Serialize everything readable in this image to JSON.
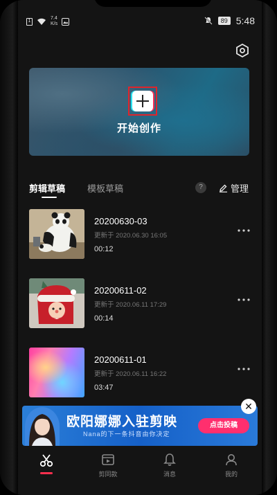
{
  "status_bar": {
    "sim_label": "1",
    "net_speed_value": "7.4",
    "net_speed_unit": "K/s",
    "battery": "89",
    "time": "5:48"
  },
  "hero": {
    "create_label": "开始创作"
  },
  "tabs": {
    "drafts": "剪辑草稿",
    "templates": "模板草稿",
    "help": "?",
    "manage": "管理"
  },
  "drafts": [
    {
      "name": "20200630-03",
      "updated": "更新于 2020.06.30 16:05",
      "duration": "00:12",
      "thumb": "panda"
    },
    {
      "name": "20200611-02",
      "updated": "更新于 2020.06.11 17:29",
      "duration": "00:14",
      "thumb": "santa"
    },
    {
      "name": "20200611-01",
      "updated": "更新于 2020.06.11 16:22",
      "duration": "03:47",
      "thumb": "gradient"
    }
  ],
  "ad": {
    "title": "欧阳娜娜入驻剪映",
    "subtitle": "Nana的下一条抖音由你决定",
    "cta": "点击投稿",
    "close": "✕"
  },
  "nav": {
    "cut": "",
    "template": "剪同款",
    "messages": "消息",
    "me": "我的"
  },
  "colors": {
    "accent": "#ff2f4e",
    "background": "#141414",
    "ad_blue": "#1560c8"
  }
}
